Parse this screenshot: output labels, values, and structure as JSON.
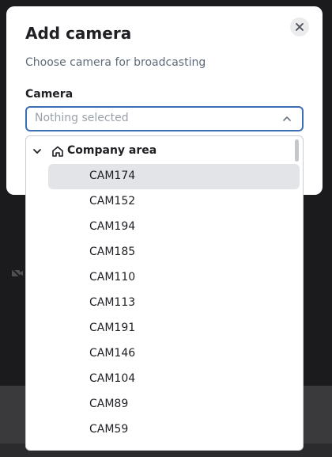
{
  "modal": {
    "title": "Add camera",
    "subtitle": "Choose camera for broadcasting",
    "close_icon": "close-icon"
  },
  "camera_field": {
    "label": "Camera",
    "placeholder": "Nothing selected",
    "chevron_icon": "chevron-up-icon"
  },
  "dropdown": {
    "group": {
      "label": "Company area",
      "expand_icon": "chevron-down-icon",
      "icon": "home-icon"
    },
    "options": [
      {
        "label": "CAM174",
        "highlighted": true
      },
      {
        "label": "CAM152"
      },
      {
        "label": "CAM194"
      },
      {
        "label": "CAM185"
      },
      {
        "label": "CAM110"
      },
      {
        "label": "CAM113"
      },
      {
        "label": "CAM191"
      },
      {
        "label": "CAM146"
      },
      {
        "label": "CAM104"
      },
      {
        "label": "CAM89"
      },
      {
        "label": "CAM59"
      }
    ]
  },
  "colors": {
    "accent": "#3b6fb6",
    "backdrop": "#1b1b1d",
    "highlight": "#e3e4e7"
  }
}
